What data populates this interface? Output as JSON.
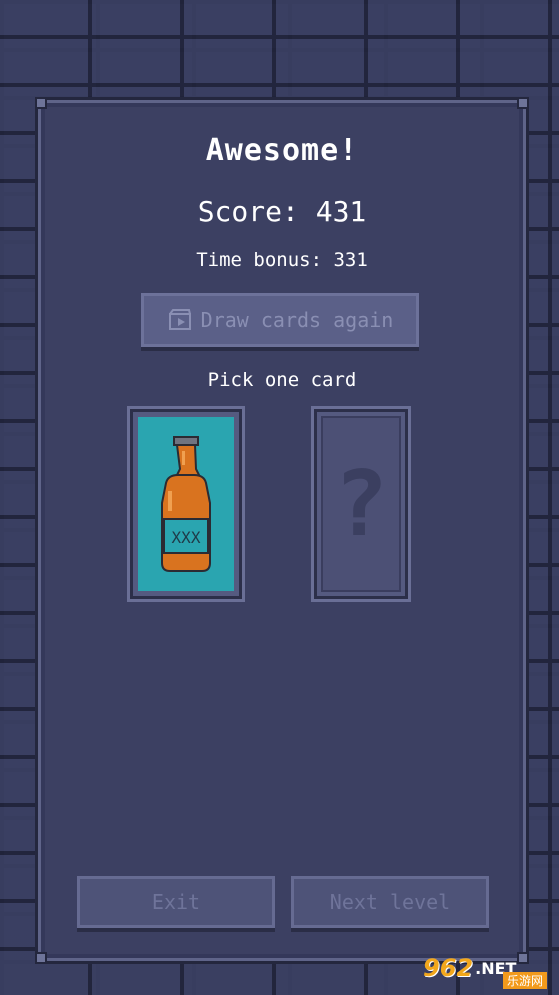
{
  "dialog": {
    "title": "Awesome!",
    "score_text": "Score: 431",
    "time_bonus_text": "Time bonus: 331",
    "draw_again_label": "Draw cards again",
    "pick_prompt": "Pick one card"
  },
  "cards": [
    {
      "state": "revealed",
      "image": "poison-bottle",
      "label": "XXX"
    },
    {
      "state": "hidden",
      "symbol": "?"
    }
  ],
  "buttons": {
    "exit_label": "Exit",
    "next_level_label": "Next level"
  },
  "watermark": {
    "number": "962",
    "suffix": ".NET",
    "sub": "乐游网"
  },
  "colors": {
    "panel": "#3c4062",
    "card_face": "#2aa5b0",
    "bottle": "#d9731f"
  }
}
